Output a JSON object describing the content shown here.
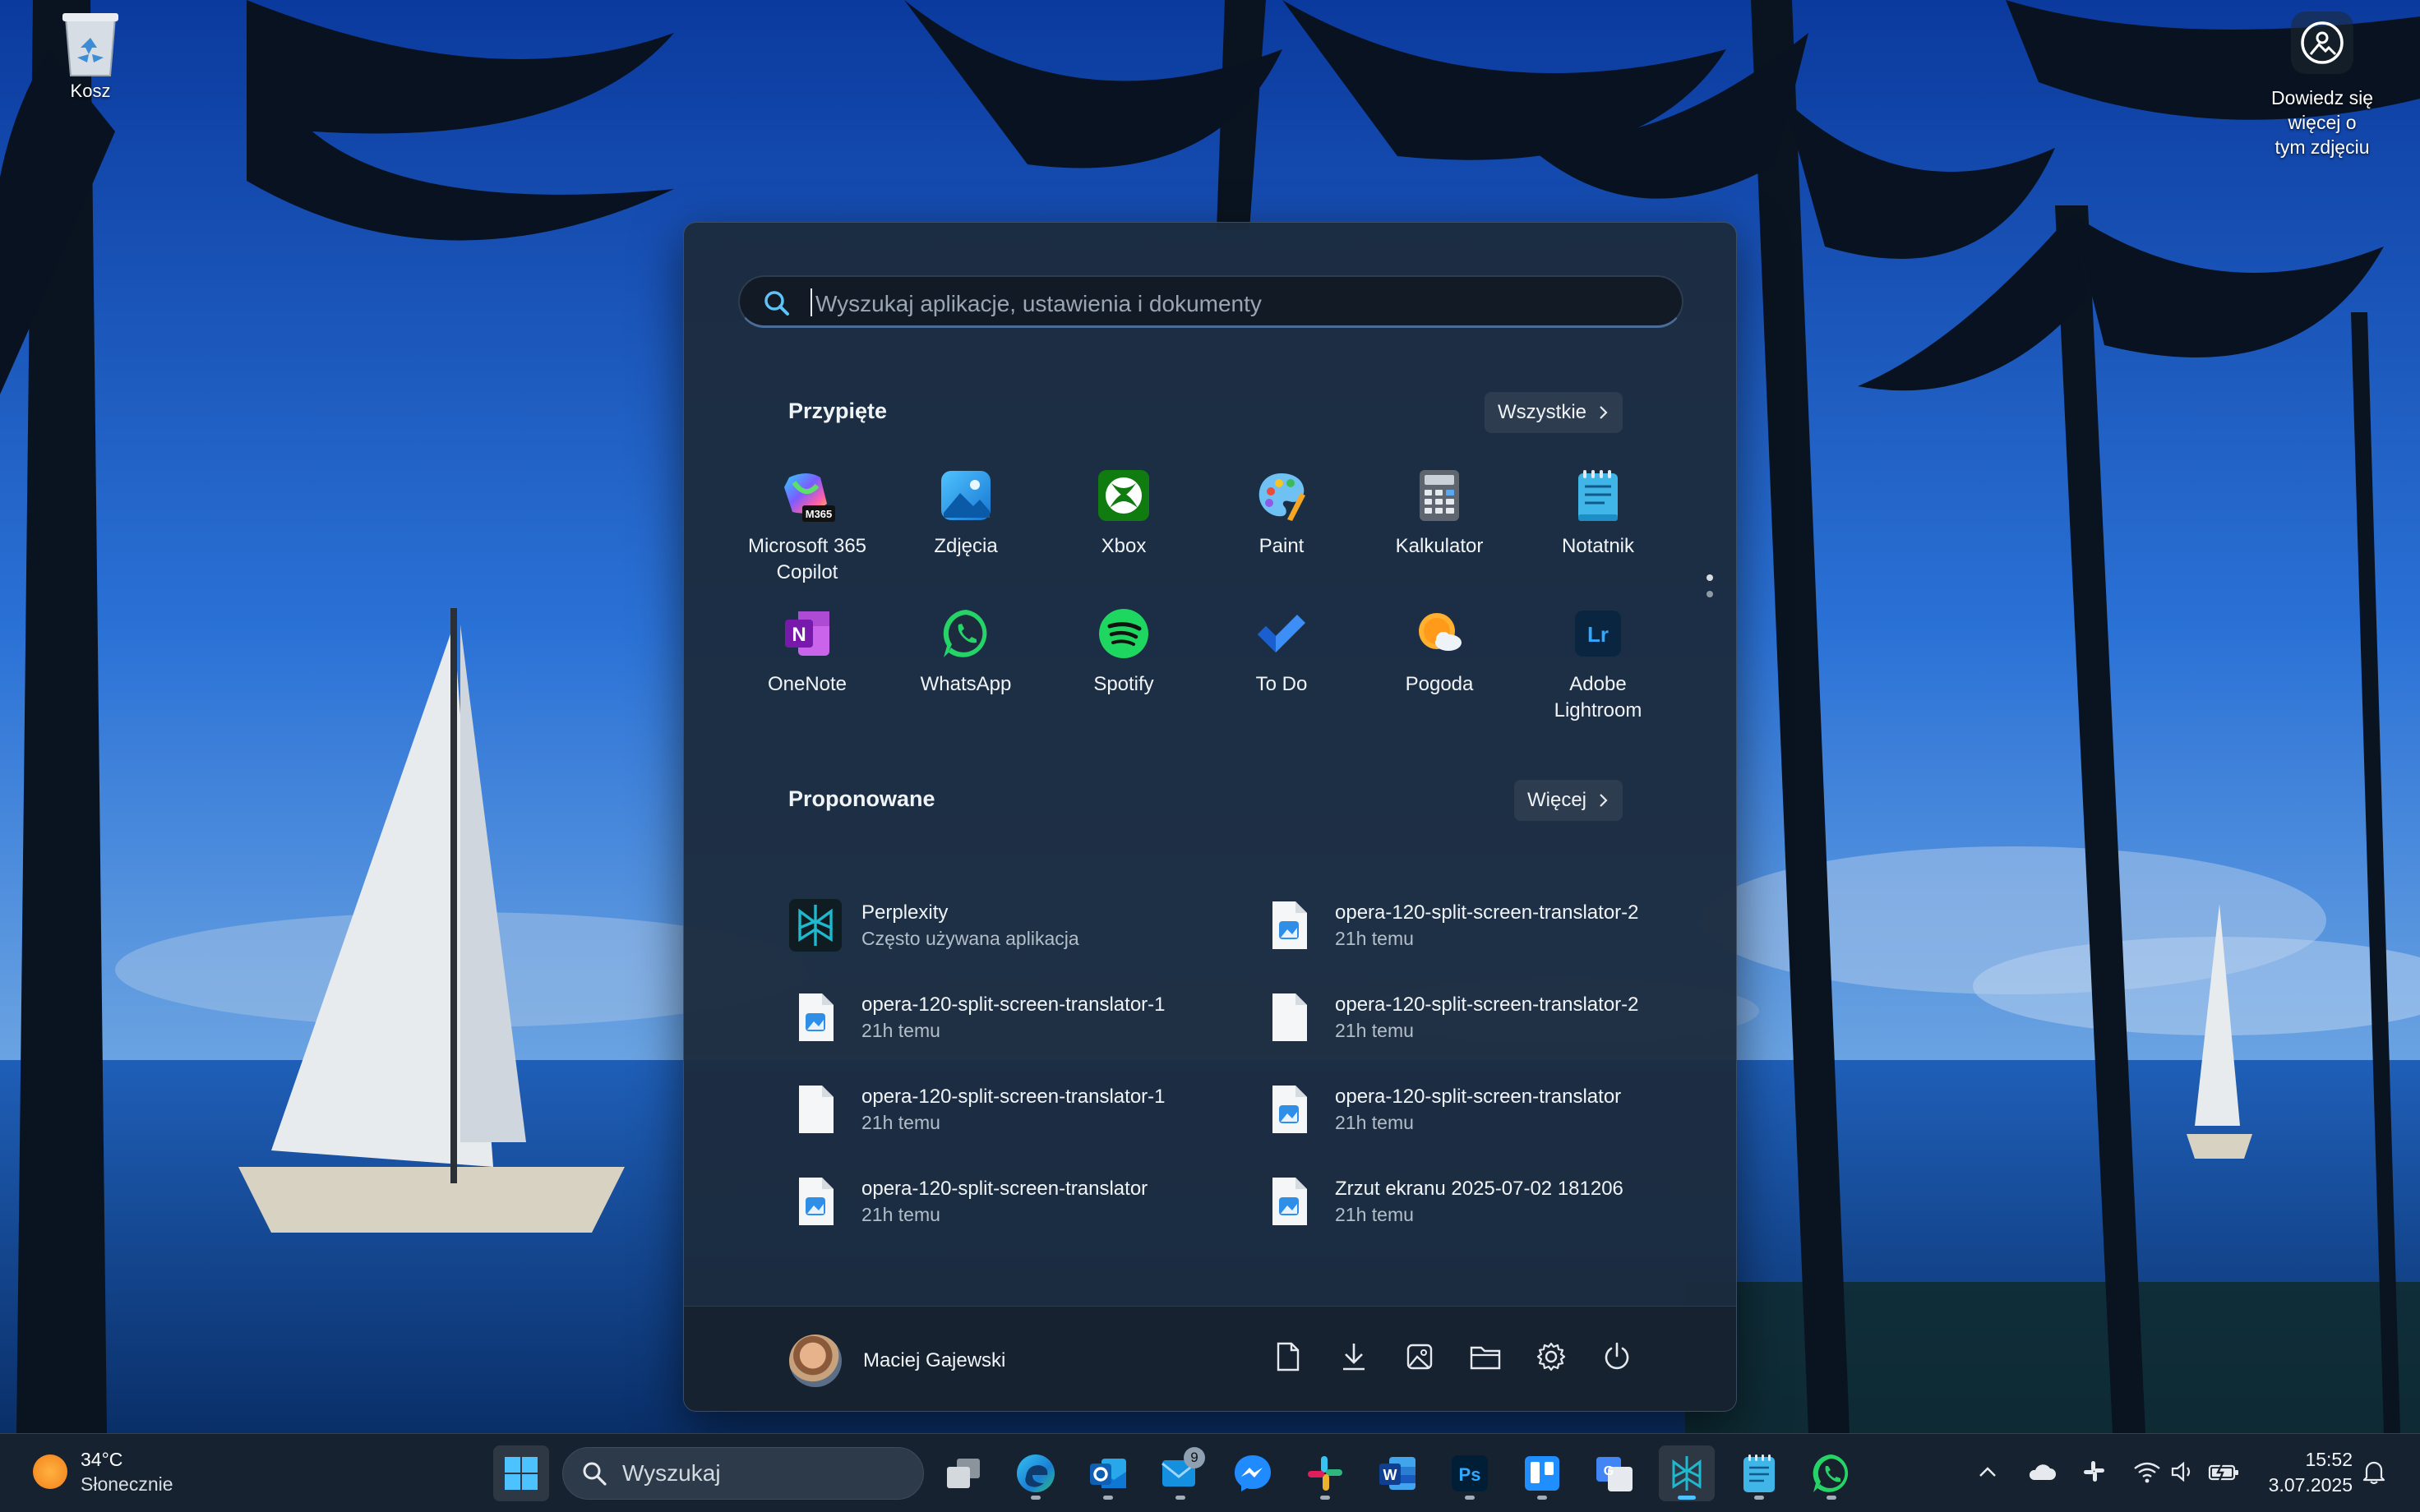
{
  "desktop": {
    "recycle_bin_label": "Kosz",
    "photo_info_label_line1": "Dowiedz się więcej o",
    "photo_info_label_line2": "tym zdjęciu"
  },
  "start_menu": {
    "search_placeholder": "Wyszukaj aplikacje, ustawienia i dokumenty",
    "pinned": {
      "title": "Przypięte",
      "all_button": "Wszystkie",
      "apps": [
        {
          "name": "Microsoft 365",
          "name2": "Copilot",
          "icon": "m365-copilot-icon"
        },
        {
          "name": "Zdjęcia",
          "name2": "",
          "icon": "photos-icon"
        },
        {
          "name": "Xbox",
          "name2": "",
          "icon": "xbox-icon"
        },
        {
          "name": "Paint",
          "name2": "",
          "icon": "paint-icon"
        },
        {
          "name": "Kalkulator",
          "name2": "",
          "icon": "calculator-icon"
        },
        {
          "name": "Notatnik",
          "name2": "",
          "icon": "notepad-icon"
        },
        {
          "name": "OneNote",
          "name2": "",
          "icon": "onenote-icon"
        },
        {
          "name": "WhatsApp",
          "name2": "",
          "icon": "whatsapp-icon"
        },
        {
          "name": "Spotify",
          "name2": "",
          "icon": "spotify-icon"
        },
        {
          "name": "To Do",
          "name2": "",
          "icon": "todo-icon"
        },
        {
          "name": "Pogoda",
          "name2": "",
          "icon": "weather-icon"
        },
        {
          "name": "Adobe",
          "name2": "Lightroom",
          "icon": "lightroom-icon"
        }
      ],
      "m365_badge": "M365",
      "onenote_letter": "N",
      "lightroom_letters": "Lr"
    },
    "recommended": {
      "title": "Proponowane",
      "more_button": "Więcej",
      "items": [
        {
          "title": "Perplexity",
          "subtitle": "Często używana aplikacja",
          "icon": "perplexity-icon"
        },
        {
          "title": "opera-120-split-screen-translator-2",
          "subtitle": "21h temu",
          "icon": "image-file-icon"
        },
        {
          "title": "opera-120-split-screen-translator-1",
          "subtitle": "21h temu",
          "icon": "image-file-icon"
        },
        {
          "title": "opera-120-split-screen-translator-2",
          "subtitle": "21h temu",
          "icon": "blank-file-icon"
        },
        {
          "title": "opera-120-split-screen-translator-1",
          "subtitle": "21h temu",
          "icon": "blank-file-icon"
        },
        {
          "title": "opera-120-split-screen-translator",
          "subtitle": "21h temu",
          "icon": "image-file-icon"
        },
        {
          "title": "opera-120-split-screen-translator",
          "subtitle": "21h temu",
          "icon": "image-file-icon"
        },
        {
          "title": "Zrzut ekranu 2025-07-02 181206",
          "subtitle": "21h temu",
          "icon": "image-file-icon"
        }
      ]
    },
    "user_name": "Maciej Gajewski"
  },
  "taskbar": {
    "weather_temp": "34°C",
    "weather_desc": "Słonecznie",
    "search_label": "Wyszukaj",
    "mail_badge": "9",
    "word_letter": "W",
    "ps_letters": "Ps",
    "time": "15:52",
    "date": "3.07.2025"
  },
  "colors": {
    "start_bg": "#1c2c3e",
    "accent": "#4cc2ff",
    "taskbar_bg": "#18222e"
  }
}
